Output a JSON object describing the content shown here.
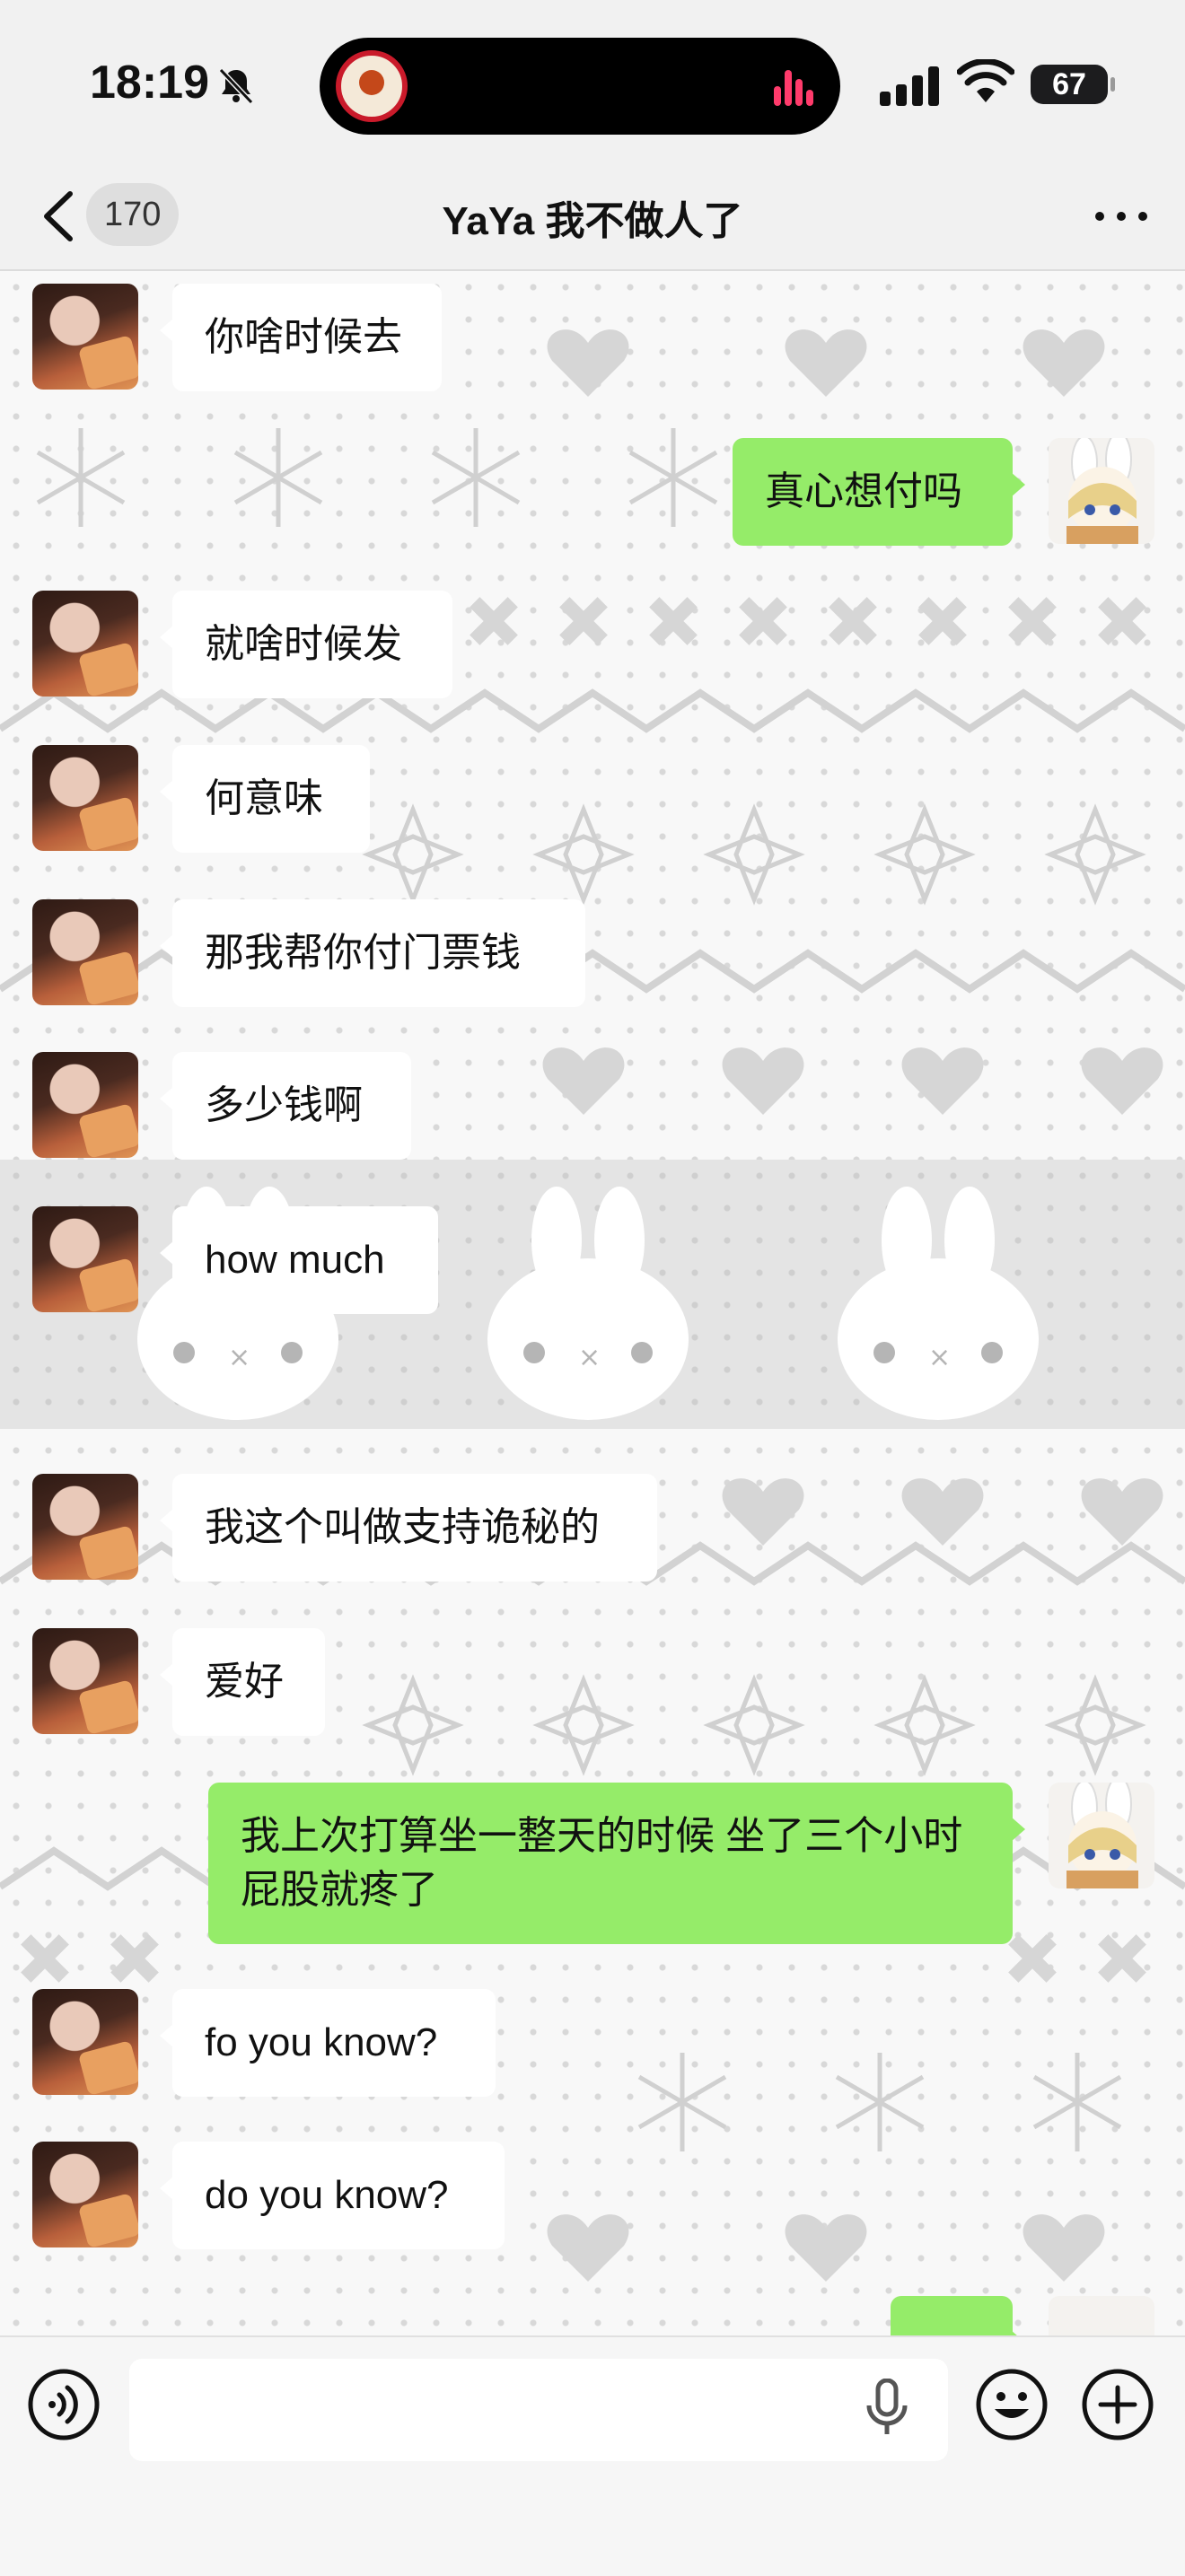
{
  "status_bar": {
    "time": "18:19",
    "battery": "67",
    "icons": [
      "bell-slash-icon",
      "cellular-signal-icon",
      "wifi-icon",
      "battery-icon",
      "audio-bars-icon"
    ]
  },
  "nav": {
    "back_count": "170",
    "title": "YaYa 我不做人了",
    "icons": [
      "back-chevron-icon",
      "more-icon"
    ]
  },
  "messages": [
    {
      "side": "left",
      "text": "你啥时候去"
    },
    {
      "side": "right",
      "text": "真心想付吗"
    },
    {
      "side": "left",
      "text": "就啥时候发"
    },
    {
      "side": "left",
      "text": "何意味"
    },
    {
      "side": "left",
      "text": "那我帮你付门票钱"
    },
    {
      "side": "left",
      "text": "多少钱啊"
    },
    {
      "side": "left",
      "text": "how much"
    },
    {
      "side": "left",
      "text": "我这个叫做支持诡秘的"
    },
    {
      "side": "left",
      "text": "爱好"
    },
    {
      "side": "right",
      "text": "我上次打算坐一整天的时候 坐了三个小时屁股就疼了"
    },
    {
      "side": "left",
      "text": "fo you know?"
    },
    {
      "side": "left",
      "text": "do you know?"
    },
    {
      "side": "right",
      "text": ""
    }
  ],
  "input_bar": {
    "placeholder": "",
    "icons": [
      "voice-icon",
      "microphone-icon",
      "emoji-icon",
      "plus-icon"
    ]
  },
  "colors": {
    "sent_bubble": "#95ec69",
    "received_bubble": "#ffffff",
    "background": "#f1f1f1"
  }
}
